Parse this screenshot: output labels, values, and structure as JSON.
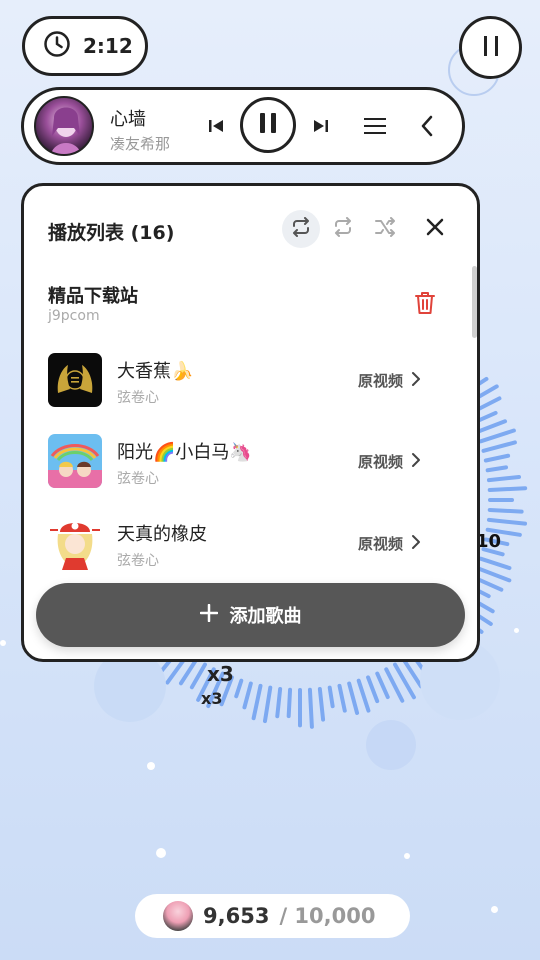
{
  "timer": {
    "label": "2:12",
    "icon": "clock-icon"
  },
  "top_controls": {
    "pause_icon": "pause-icon"
  },
  "player": {
    "title": "心墙",
    "artist": "凑友希那"
  },
  "playlist": {
    "title": "播放列表 (16)",
    "source": {
      "name": "精品下载站",
      "sub": "j9pcom"
    },
    "songs": [
      {
        "title": "大香蕉🍌",
        "artist": "弦卷心",
        "link_label": "原视频"
      },
      {
        "title": "阳光🌈小白马🦄",
        "artist": "弦卷心",
        "link_label": "原视频"
      },
      {
        "title": "天真的橡皮",
        "artist": "弦卷心",
        "link_label": "原视频"
      }
    ],
    "add_label": "添加歌曲"
  },
  "overlay": {
    "combo_a": "x3",
    "combo_b": "x3",
    "side_number": "10"
  },
  "score": {
    "value": "9,653",
    "max": "/ 10,000"
  },
  "colors": {
    "accent_dark": "#222222",
    "add_button": "#575757",
    "delete": "#e0433a",
    "visualizer": "#6fa0f0"
  }
}
